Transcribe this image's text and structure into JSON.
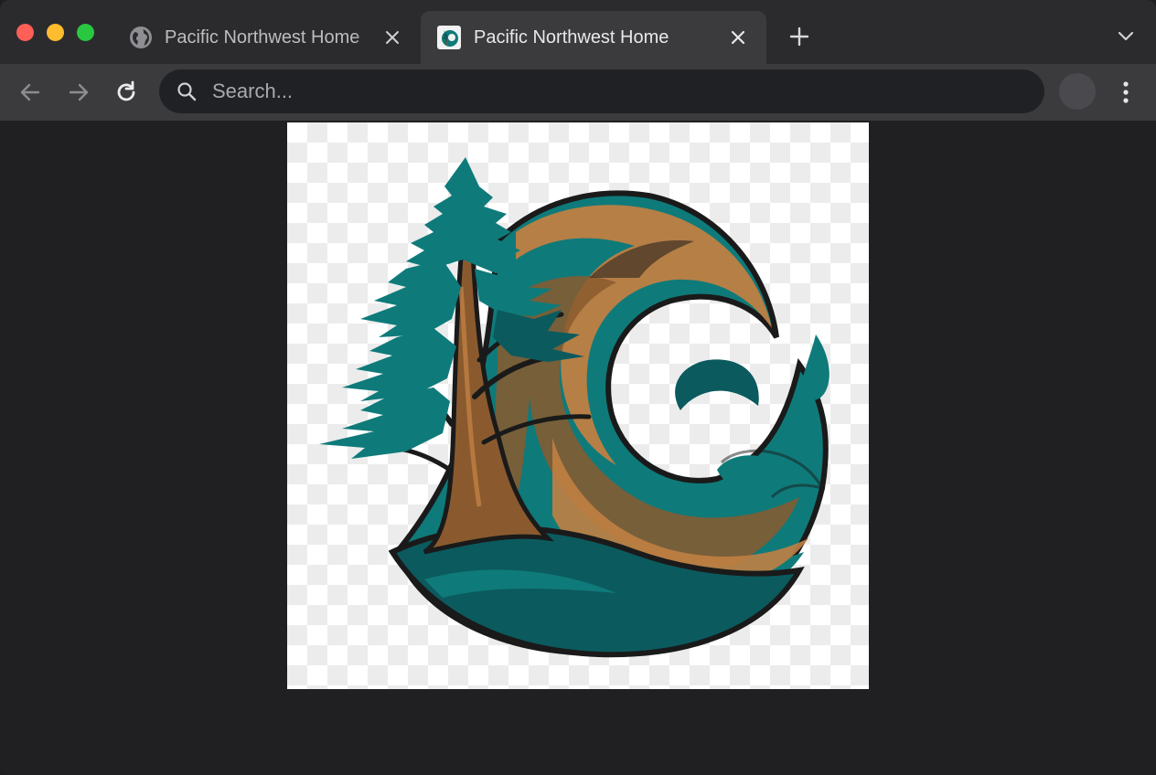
{
  "window": {
    "controls": [
      "close",
      "minimize",
      "zoom"
    ]
  },
  "tabs": [
    {
      "label": "Pacific Northwest Home",
      "active": false,
      "favicon": "globe-icon"
    },
    {
      "label": "Pacific Northwest Home",
      "active": true,
      "favicon": "site-logo-icon"
    }
  ],
  "toolbar": {
    "search_placeholder": "Search..."
  },
  "content": {
    "image": "pacific-northwest-logo",
    "colors": {
      "teal": "#0f7a7a",
      "dark_teal": "#0b5a5e",
      "brown": "#8a5a2e",
      "tan": "#c07f43",
      "outline": "#1a1a1a"
    }
  }
}
